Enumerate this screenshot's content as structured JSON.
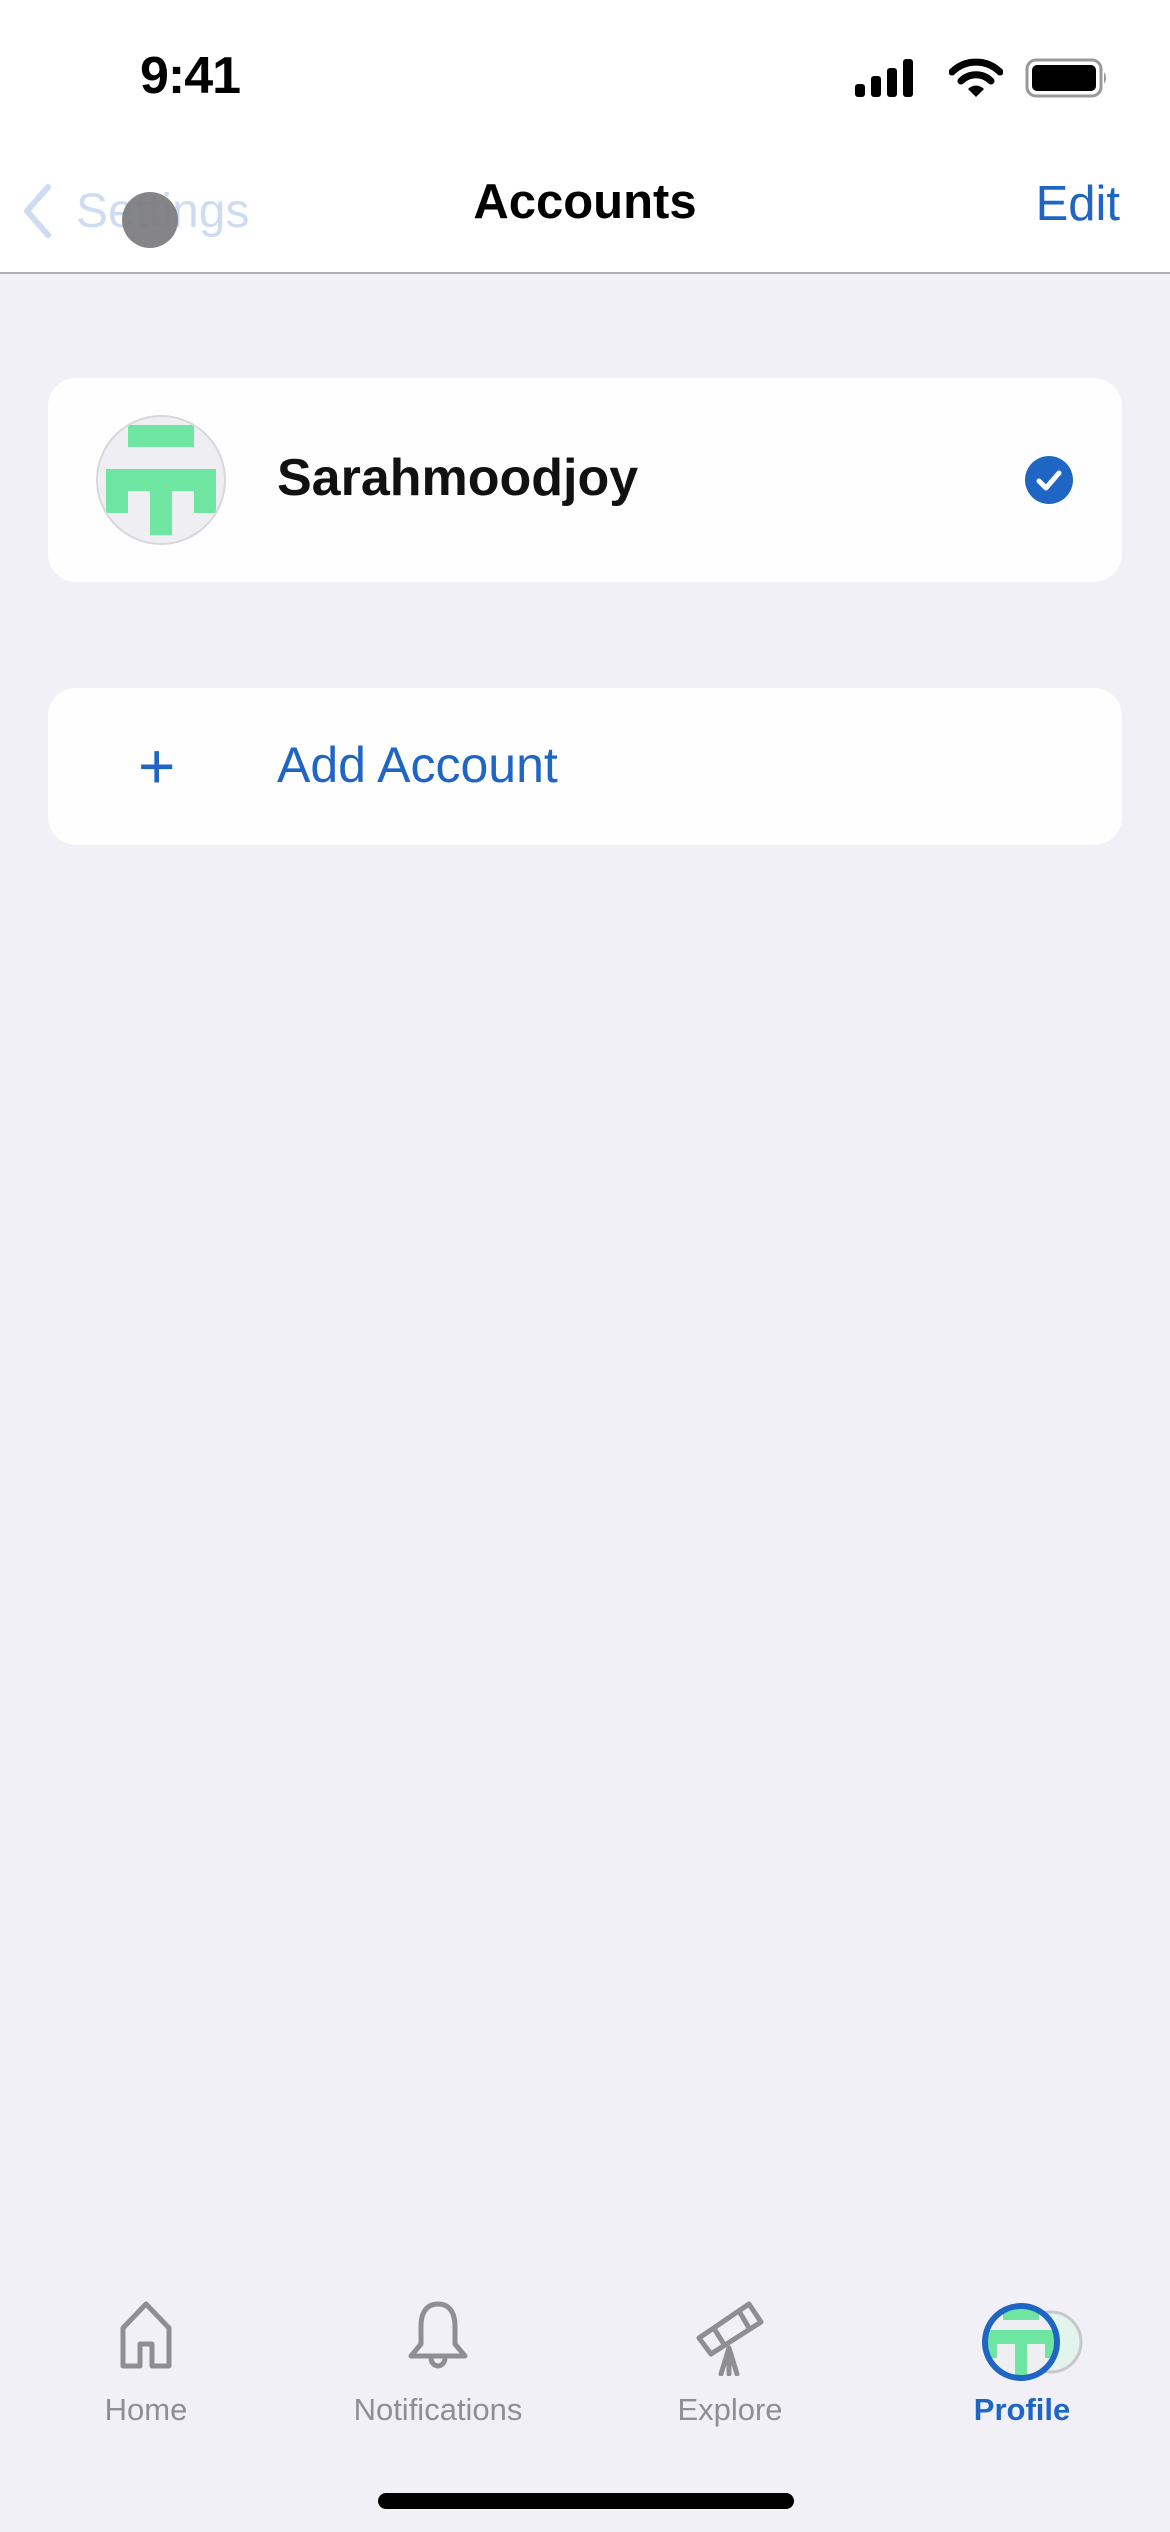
{
  "status_bar": {
    "time": "9:41",
    "icons": [
      "cellular-signal-icon",
      "wifi-icon",
      "battery-icon"
    ]
  },
  "nav_bar": {
    "back_label": "Settings",
    "title": "Accounts",
    "edit_label": "Edit"
  },
  "accounts": [
    {
      "name": "Sarahmoodjoy",
      "selected": true
    }
  ],
  "add_account": {
    "label": "Add Account",
    "icon": "+"
  },
  "tabs": [
    {
      "label": "Home",
      "icon": "house-icon",
      "active": false
    },
    {
      "label": "Notifications",
      "icon": "bell-icon",
      "active": false
    },
    {
      "label": "Explore",
      "icon": "telescope-icon",
      "active": false
    },
    {
      "label": "Profile",
      "icon": "avatar-icon",
      "active": true
    }
  ],
  "colors": {
    "accent": "#1f66c4",
    "identicon": "#6ee5a0",
    "background": "#f0f0f6",
    "tab_inactive": "#8e8e93"
  }
}
